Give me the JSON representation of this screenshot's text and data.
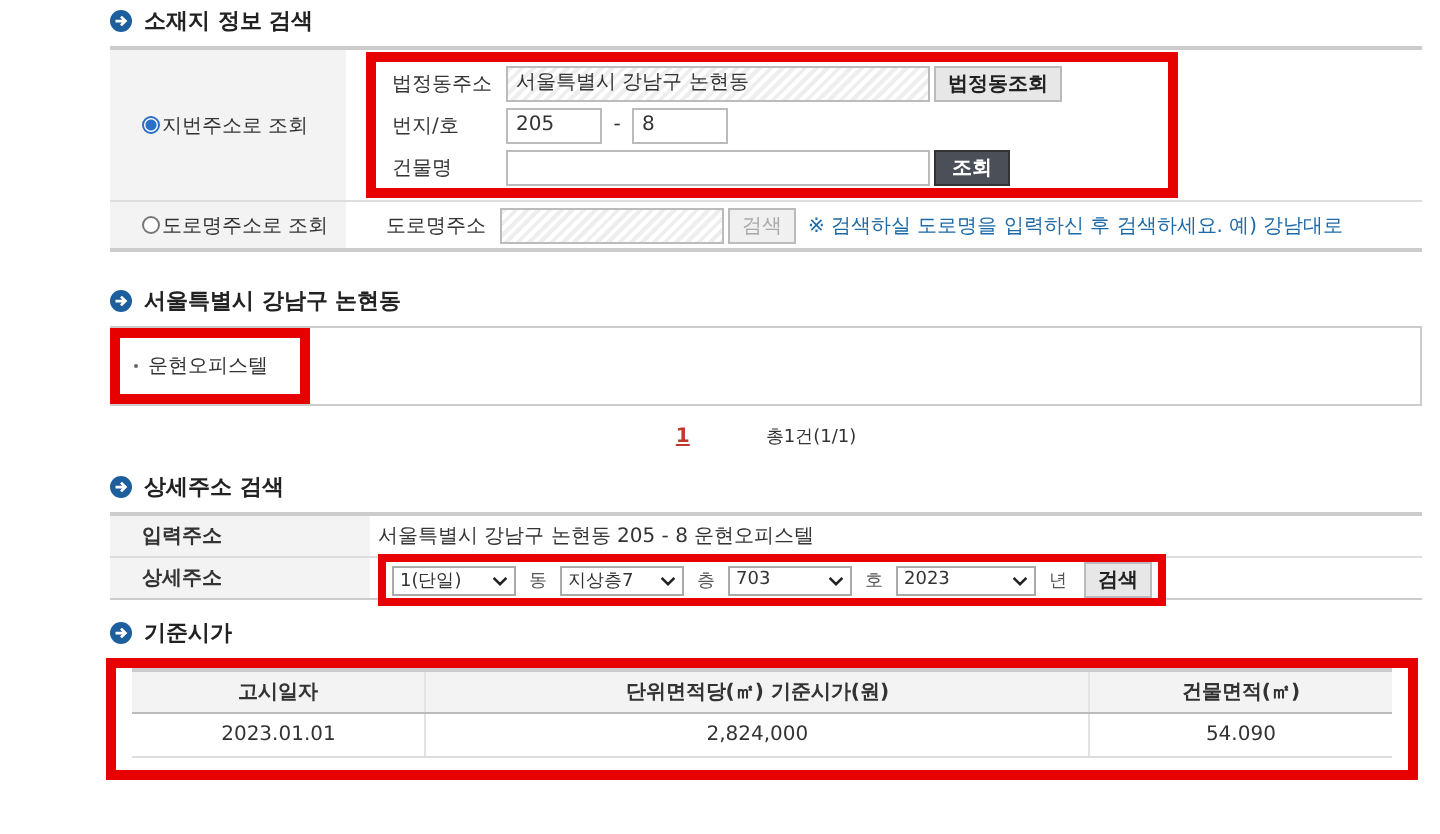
{
  "location_search": {
    "title": "소재지 정보 검색",
    "options": [
      {
        "kind": "lot",
        "label": "지번주소로 조회",
        "selected": true,
        "highlighted": true,
        "rows": [
          {
            "kind": "readonly",
            "label": "법정동주소",
            "value": "서울특별시 강남구 논현동",
            "button": "법정동조회"
          },
          {
            "kind": "pair",
            "label": "번지/호",
            "value": "205",
            "separator": "-",
            "value2": "8"
          },
          {
            "kind": "text",
            "label": "건물명",
            "button": "조회"
          }
        ]
      },
      {
        "kind": "road",
        "label": "도로명주소로 조회",
        "selected": false,
        "highlighted": false,
        "field_label": "도로명주소",
        "button": "검색",
        "disabled": true,
        "hint": "※ 검색하실 도로명을 입력하신 후 검색하세요. 예) 강남대로"
      }
    ]
  },
  "results": {
    "title": "서울특별시 강남구 논현동",
    "items": [
      {
        "label": "운현오피스텔",
        "highlighted": true
      }
    ],
    "pages": [
      {
        "label": "1",
        "selected": true
      }
    ],
    "summary": "총1건(1/1)"
  },
  "detail_search": {
    "title": "상세주소 검색",
    "input_label": "입력주소",
    "input_value": "서울특별시 강남구 논현동 205 - 8 운현오피스텔",
    "detail_label": "상세주소",
    "highlighted": true,
    "selects": [
      {
        "value": "1(단일)",
        "unit": "동"
      },
      {
        "value": "지상층7",
        "unit": "층"
      },
      {
        "value": "703",
        "unit": "호"
      },
      {
        "value": "2023",
        "unit": "년"
      }
    ],
    "button": "검색"
  },
  "price": {
    "title": "기준시가",
    "highlighted": true,
    "columns": [
      "고시일자",
      "단위면적당(㎡) 기준시가(원)",
      "건물면적(㎡)"
    ],
    "rows": [
      [
        "2023.01.01",
        "2,824,000",
        "54.090"
      ]
    ]
  }
}
